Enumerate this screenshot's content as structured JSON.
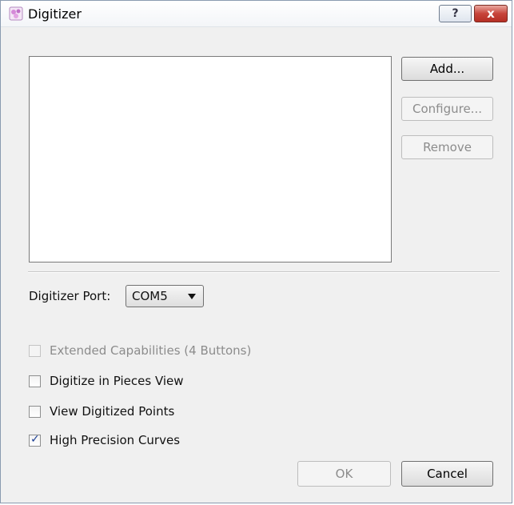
{
  "window": {
    "title": "Digitizer",
    "help_label": "?",
    "close_label": "x"
  },
  "side_buttons": {
    "add": "Add...",
    "configure": "Configure...",
    "remove": "Remove"
  },
  "port": {
    "label": "Digitizer Port:",
    "value": "COM5"
  },
  "options": [
    {
      "label": "Extended Capabilities (4 Buttons)",
      "checked": false,
      "enabled": false
    },
    {
      "label": "Digitize in Pieces View",
      "checked": false,
      "enabled": true
    },
    {
      "label": "View Digitized Points",
      "checked": false,
      "enabled": true
    },
    {
      "label": "High Precision Curves",
      "checked": true,
      "enabled": true
    }
  ],
  "footer": {
    "ok": "OK",
    "cancel": "Cancel"
  }
}
